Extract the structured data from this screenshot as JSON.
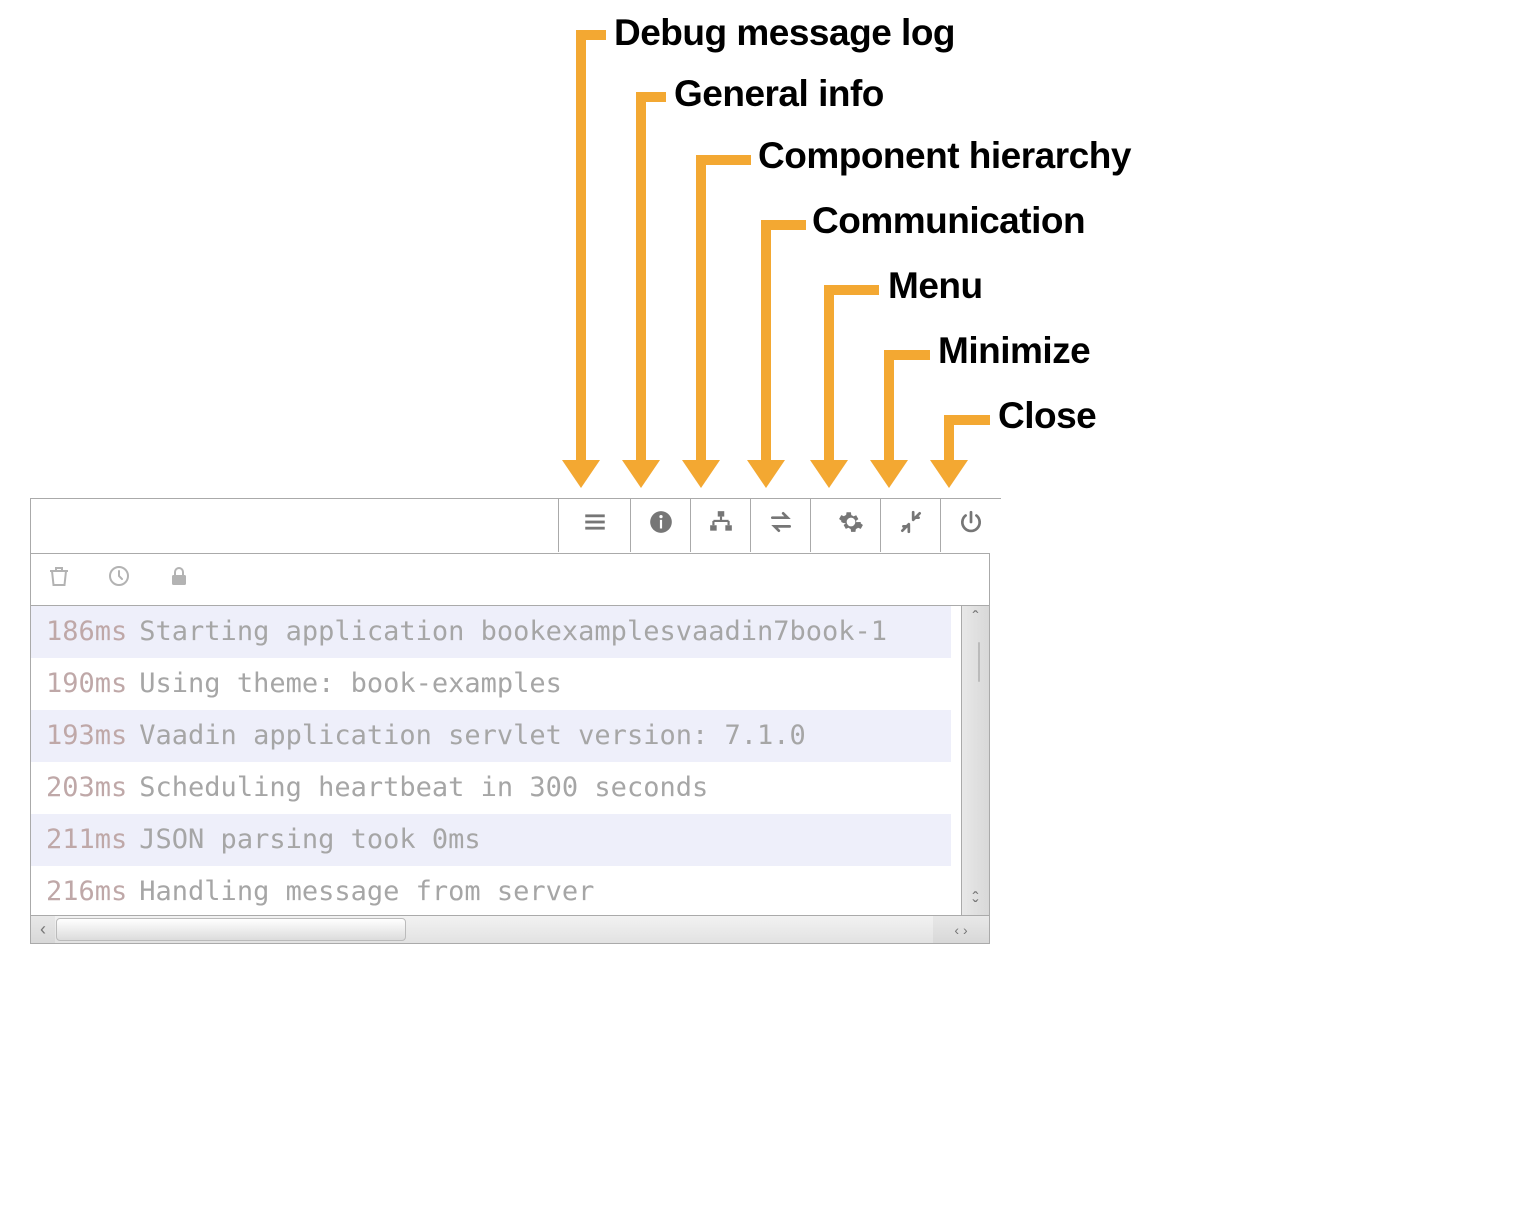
{
  "callouts": [
    {
      "label": "Debug message log"
    },
    {
      "label": "General info"
    },
    {
      "label": "Component hierarchy"
    },
    {
      "label": "Communication"
    },
    {
      "label": "Menu"
    },
    {
      "label": "Minimize"
    },
    {
      "label": "Close"
    }
  ],
  "tabs": [
    {
      "name": "log-tab"
    },
    {
      "name": "info-tab"
    },
    {
      "name": "hierarchy-tab"
    },
    {
      "name": "communication-tab"
    },
    {
      "name": "menu-tab"
    },
    {
      "name": "minimize-tab"
    },
    {
      "name": "close-tab"
    }
  ],
  "tools": [
    {
      "name": "clear-log"
    },
    {
      "name": "reset-timer"
    },
    {
      "name": "lock-scroll"
    }
  ],
  "log": [
    {
      "time": "186ms",
      "text": "Starting application bookexamplesvaadin7book-1"
    },
    {
      "time": "190ms",
      "text": "Using theme: book-examples"
    },
    {
      "time": "193ms",
      "text": "Vaadin application servlet version: 7.1.0"
    },
    {
      "time": "203ms",
      "text": "Scheduling heartbeat in 300 seconds"
    },
    {
      "time": "211ms",
      "text": "JSON parsing took 0ms"
    },
    {
      "time": "216ms",
      "text": "Handling message from server"
    }
  ]
}
